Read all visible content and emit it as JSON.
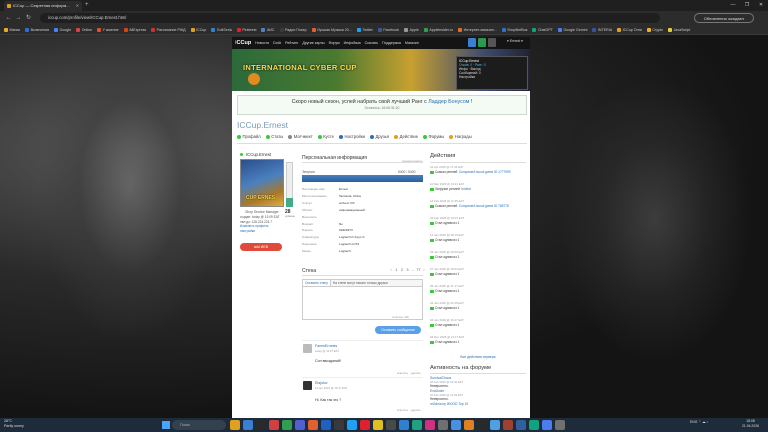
{
  "browser": {
    "tab_title": "ICCup — Секретная информ...",
    "new_tab": "+",
    "url": "iccup.com/profile/view/ICCup.Ernest.html",
    "update_button": "Обновления ожидают",
    "back": "←",
    "forward": "→",
    "reload": "↻",
    "window_controls": [
      "—",
      "❐",
      "✕"
    ],
    "bookmarks": [
      {
        "label": "Мапки",
        "color": "#e8b020"
      },
      {
        "label": "Включения",
        "color": "#2a6fd6"
      },
      {
        "label": "Google",
        "color": "#4285f4"
      },
      {
        "label": "Online",
        "color": "#e04040"
      },
      {
        "label": "У жжение",
        "color": "#e05030"
      },
      {
        "label": "AliExpress",
        "color": "#e04010"
      },
      {
        "label": "Расписание РЖД",
        "color": "#d03030"
      },
      {
        "label": "ICCup",
        "color": "#e0a020"
      },
      {
        "label": "GoltSeria",
        "color": "#3080d0"
      },
      {
        "label": "Pinterest",
        "color": "#e02030"
      },
      {
        "label": "АИС",
        "color": "#5080c0"
      },
      {
        "label": "Радио Покер",
        "color": "#3a3a3a"
      },
      {
        "label": "Лучшая Музыка 20...",
        "color": "#e06030"
      },
      {
        "label": "Twitter",
        "color": "#1da1f2"
      },
      {
        "label": "Facebook",
        "color": "#3b5998"
      },
      {
        "label": "Apple",
        "color": "#999999"
      },
      {
        "label": "Appleinsider.ru",
        "color": "#30a050"
      },
      {
        "label": "Интернет-магазин...",
        "color": "#e07020"
      },
      {
        "label": "ShopNetBus",
        "color": "#3070d0"
      },
      {
        "label": "ChatGPT",
        "color": "#10a37f"
      },
      {
        "label": "Google Gemini",
        "color": "#4a7ef0"
      },
      {
        "label": "INTERIA",
        "color": "#3a50a0"
      },
      {
        "label": "ICCup Огни",
        "color": "#e0a020"
      },
      {
        "label": "Crypto",
        "color": "#f0b020"
      },
      {
        "label": "JavaScript",
        "color": "#e0d030"
      }
    ]
  },
  "site": {
    "logo_prefix": "i",
    "logo_rest": "CCup",
    "nav": [
      "Новости",
      "DotA",
      "Рейтинг",
      "Другие карты",
      "Форум",
      "Инфобаза",
      "Скачать",
      "Поддержка",
      "Магазин"
    ],
    "user_menu": "▾ Ernest ▾",
    "banner_title": "INTERNATIONAL CYBER CUP",
    "popup": {
      "name": "ICCup.Ernest",
      "line1": "Очков: 0 · Ранг: 0",
      "line2": "Инфо · Выход",
      "line3": "Сообщений: 0",
      "line4": "Настройки"
    }
  },
  "notice": {
    "text_before": "Скоро новый сезон, успей набрать свой лучший Ранг с ",
    "link": "Ладдер Бонусом",
    "text_after": " !",
    "countdown": "Осталось: 16:06:31:20"
  },
  "profile": {
    "name_title": "ICCup.Ernest",
    "tabs": [
      {
        "label": "Профайл",
        "color": "#3c3"
      },
      {
        "label": "Статы",
        "color": "#3c3"
      },
      {
        "label": "Матчмект",
        "color": "#888"
      },
      {
        "label": "Кусте",
        "color": "#3c3"
      },
      {
        "label": "Настройки",
        "color": "#2a6fb0"
      },
      {
        "label": "Друзья",
        "color": "#2a6fb0"
      },
      {
        "label": "Действие",
        "color": "#e0a020"
      },
      {
        "label": "Форумы",
        "color": "#3c3"
      },
      {
        "label": "Награды",
        "color": "#e0a020"
      }
    ],
    "small_name": "ICCup.Ernest",
    "avatar_caption": "CUP ERNES",
    "level": "28",
    "level_label": "уровень",
    "level_progress_pct": 20,
    "rank_title": "Shop Service Manager",
    "info_lines": [
      "создан: today @ 13:09 EAT",
      "лвл до: 128.224.224.7",
      "Изменить профиль",
      "настройки"
    ],
    "add_friend": "add ИЕВ"
  },
  "personal": {
    "title": "Персональная информация",
    "edit_link": "редактировать",
    "energy_label": "Энергия",
    "energy_value": "5400 / 5400",
    "energy_pct": 100,
    "fields": [
      {
        "k": "Настоящее имя",
        "v": "Ernest"
      },
      {
        "k": "Местоположение",
        "v": "Tanzania, Africa"
      },
      {
        "k": "Статус",
        "v": "arrived: 2/3"
      },
      {
        "k": "Област.",
        "v": "информационный"
      },
      {
        "k": "Веселость",
        "v": ""
      },
      {
        "k": "Возраст",
        "v": "No"
      },
      {
        "k": "Пароль",
        "v": "09429973"
      },
      {
        "k": "Клавиатура",
        "v": "Logitech K-Keys S"
      },
      {
        "k": "Наушники",
        "v": "Logitech G733"
      },
      {
        "k": "Мышь",
        "v": "Logitech"
      }
    ]
  },
  "wall": {
    "title": "Стена",
    "pages": [
      "‹",
      "1",
      "2",
      "3",
      "...",
      "77",
      "›"
    ],
    "tab_active": "Оставить стену",
    "tab_note": "На стене могут писать только друзья",
    "counter": "осталось: 300",
    "send": "Оставить сообщение",
    "posts": [
      {
        "name": "FarewErnests",
        "date": "today @ 11:07 EAT",
        "text": "Сон ввозданий!",
        "actions": "ответить · удалить"
      },
      {
        "name": "Elajidov",
        "date": "12 apr 2024 @ 16:37 EAT",
        "text": "Hi. Как так эго ?",
        "actions": "ответить · удалить"
      }
    ]
  },
  "activity": {
    "title": "Действия",
    "items": [
      {
        "date": "22 Apr 2026 @ 17:44 EAT",
        "text": "Скачал реплей ",
        "link": "Composer/Liscuul game ID 1777999"
      },
      {
        "date": "10 Mar 2026 @ 13:21 EAT",
        "text": "Загрузил реплей ",
        "link": "Invited"
      },
      {
        "date": "16 Feb 2026 @ 11:35 EAT",
        "text": "Скачал реплей ",
        "link": "Composer/Liscuul game ID 785778"
      },
      {
        "date": "03 Feb 2026 @ 15:07 EAT",
        "text": "Стал одним из 1",
        "link": ""
      },
      {
        "date": "12 Jan 2026 @ 08:19 EAT",
        "text": "Стал одним из 1",
        "link": ""
      },
      {
        "date": "09 Jan 2026 @ 23:06 EAT",
        "text": "Стал одним из 1",
        "link": ""
      },
      {
        "date": "07 Jan 2026 @ 15:02 EAT",
        "text": "Стал одним из 1",
        "link": ""
      },
      {
        "date": "05 Jan 2026 @ 21:17 EAT",
        "text": "Стал одним из 1",
        "link": ""
      },
      {
        "date": "04 Jan 2026 @ 23:19 EAT",
        "text": "Стал одним из 1",
        "link": ""
      },
      {
        "date": "04 Jan 2026 @ 16:27 EAT",
        "text": "Стал одним из 1",
        "link": ""
      },
      {
        "date": "03 Dec 2025 @ 21:17 EAT",
        "text": "Стал одним из 1",
        "link": ""
      }
    ],
    "all_link": "Все действия сервера"
  },
  "forum": {
    "title": "Активность на форуме",
    "posts": [
      {
        "author": "SurvivalChaos",
        "date": "18 Feb 2026 @ 10:42 EAT",
        "text": "Невероятно."
      },
      {
        "author": "ExoDuxie",
        "date": "16 Feb 2026 @ 13:03 EAT",
        "text": "Невероятно."
      },
      {
        "author": "mOdnia by WOOD Top 10",
        "date": "",
        "text": ""
      }
    ]
  },
  "taskbar": {
    "weather_temp": "28°C",
    "weather_desc": "Partly sunny",
    "search_placeholder": "Поиск",
    "icon_colors": [
      "#e0a020",
      "#3a7fd0",
      "#2a2a2a",
      "#d04040",
      "#30a050",
      "#5060d0",
      "#e06030",
      "#2060c0",
      "#3a3a3a",
      "#1da1f2",
      "#e02030",
      "#e0c020",
      "#4a4a4a",
      "#3080d0",
      "#20a080",
      "#d03080",
      "#707070",
      "#4a90e0",
      "#e08020",
      "#2a2a2a",
      "#50a0e0",
      "#a04030",
      "#3060a0",
      "#10a37f",
      "#4a7ef0",
      "#707070"
    ],
    "tray": "ENG ⌃ ☁ ♪",
    "time": "18:08",
    "date": "21.04.2026"
  }
}
